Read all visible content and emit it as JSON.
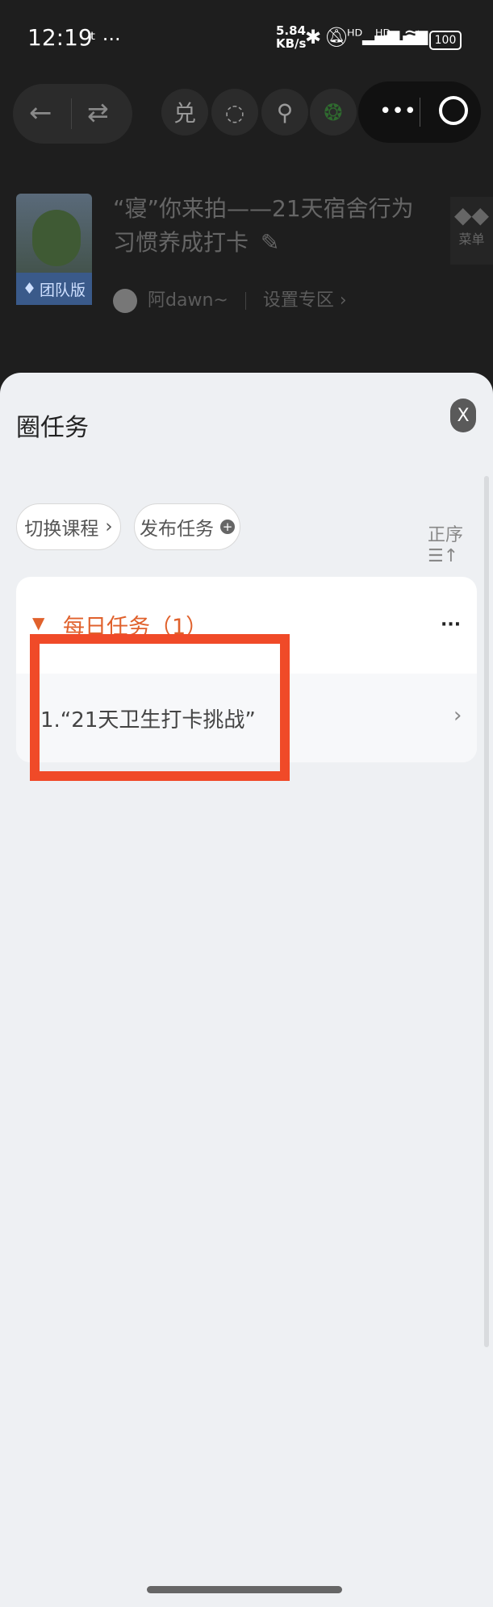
{
  "status_bar": {
    "time": "12:19",
    "network_speed": "5.84\nKB/s",
    "battery": "100"
  },
  "top_nav": {
    "exchange_label": "兑"
  },
  "header": {
    "title": "“寝”你来拍——21天宿舍行为习惯养成打卡",
    "team_badge": "团队版",
    "owner": "阿dawn~",
    "zone_link": "设置专区",
    "menu_label": "菜单"
  },
  "sheet": {
    "title": "圈任务",
    "switch_course": "切换课程",
    "publish_task": "发布任务",
    "sort_label": "正序",
    "group": {
      "title": "每日任务（1）",
      "more": "···"
    },
    "items": [
      {
        "label": "1.“21天卫生打卡挑战”"
      }
    ]
  },
  "colors": {
    "accent": "#e0612c",
    "highlight": "#f04a28",
    "sheet_bg": "#eef0f3"
  }
}
